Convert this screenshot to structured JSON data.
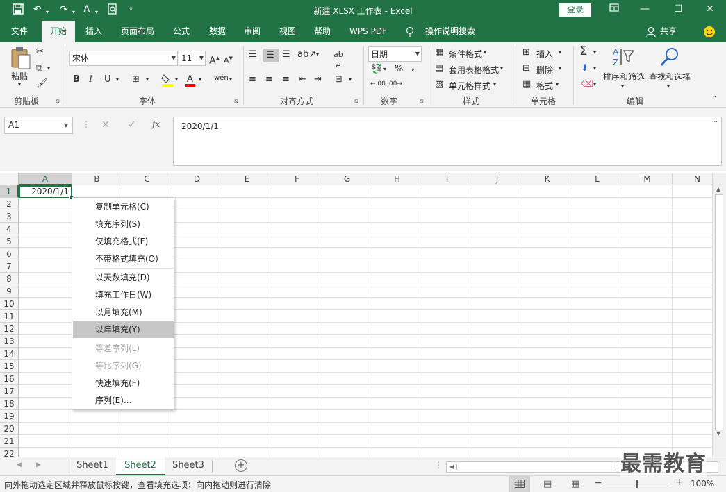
{
  "window": {
    "title": "新建 XLSX 工作表  -  Excel",
    "login_label": "登录",
    "qat_save_icon": "save-icon",
    "controls": [
      "ribbon-display-icon",
      "minimize-icon",
      "maximize-icon",
      "close-icon"
    ]
  },
  "tabs": [
    "文件",
    "开始",
    "插入",
    "页面布局",
    "公式",
    "数据",
    "审阅",
    "视图",
    "帮助",
    "WPS PDF",
    "操作说明搜索"
  ],
  "active_tab": "开始",
  "share_label": "共享",
  "ribbon": {
    "clipboard": {
      "paste_label": "粘贴",
      "group": "剪贴板"
    },
    "font": {
      "name": "宋体",
      "size": "11",
      "group": "字体",
      "bold": "B",
      "italic": "I",
      "underline": "U",
      "font_color": "#ff0000",
      "fill_color": "#ffff00",
      "phonetic": "wén"
    },
    "alignment": {
      "group": "对齐方式"
    },
    "number": {
      "format": "日期",
      "percent": "%",
      "comma": ",",
      "group": "数字",
      "inc_decimal": ".00",
      "dec_decimal": ".00"
    },
    "styles": {
      "cond_format": "条件格式",
      "table_format": "套用表格格式",
      "cell_style": "单元格样式",
      "group": "样式"
    },
    "cells": {
      "insert": "插入",
      "delete": "删除",
      "format": "格式",
      "group": "单元格"
    },
    "editing": {
      "sort_filter": "排序和筛选",
      "find_select": "查找和选择",
      "group": "编辑"
    }
  },
  "formula_bar": {
    "name_box": "A1",
    "content": "2020/1/1",
    "cancel": "✕",
    "enter": "✓",
    "fx": "fx"
  },
  "columns": [
    "A",
    "B",
    "C",
    "D",
    "E",
    "F",
    "G",
    "H",
    "I",
    "J",
    "K",
    "L",
    "M",
    "N"
  ],
  "rows": [
    "1",
    "2",
    "3",
    "4",
    "5",
    "6",
    "7",
    "8",
    "9",
    "10",
    "11",
    "12",
    "13",
    "14",
    "15",
    "16",
    "17",
    "18",
    "19",
    "20",
    "21",
    "22"
  ],
  "cell_A1": "2020/1/1",
  "menu": {
    "items": [
      {
        "label": "复制单元格(C)"
      },
      {
        "label": "填充序列(S)"
      },
      {
        "label": "仅填充格式(F)"
      },
      {
        "label": "不带格式填充(O)"
      },
      {
        "label": "以天数填充(D)"
      },
      {
        "label": "填充工作日(W)"
      },
      {
        "label": "以月填充(M)"
      },
      {
        "label": "以年填充(Y)",
        "highlighted": true
      },
      {
        "label": "等差序列(L)",
        "disabled": true
      },
      {
        "label": "等比序列(G)",
        "disabled": true
      },
      {
        "label": "快速填充(F)"
      },
      {
        "label": "序列(E)..."
      }
    ]
  },
  "sheets": [
    "Sheet1",
    "Sheet2",
    "Sheet3"
  ],
  "active_sheet": "Sheet2",
  "status": {
    "message": "向外拖动选定区域并释放鼠标按键，查看填充选项；向内拖动则进行清除",
    "zoom": "100%",
    "zoom_minus": "−",
    "zoom_plus": "+"
  },
  "watermark": "最需教育",
  "colors": {
    "accent": "#217346"
  }
}
